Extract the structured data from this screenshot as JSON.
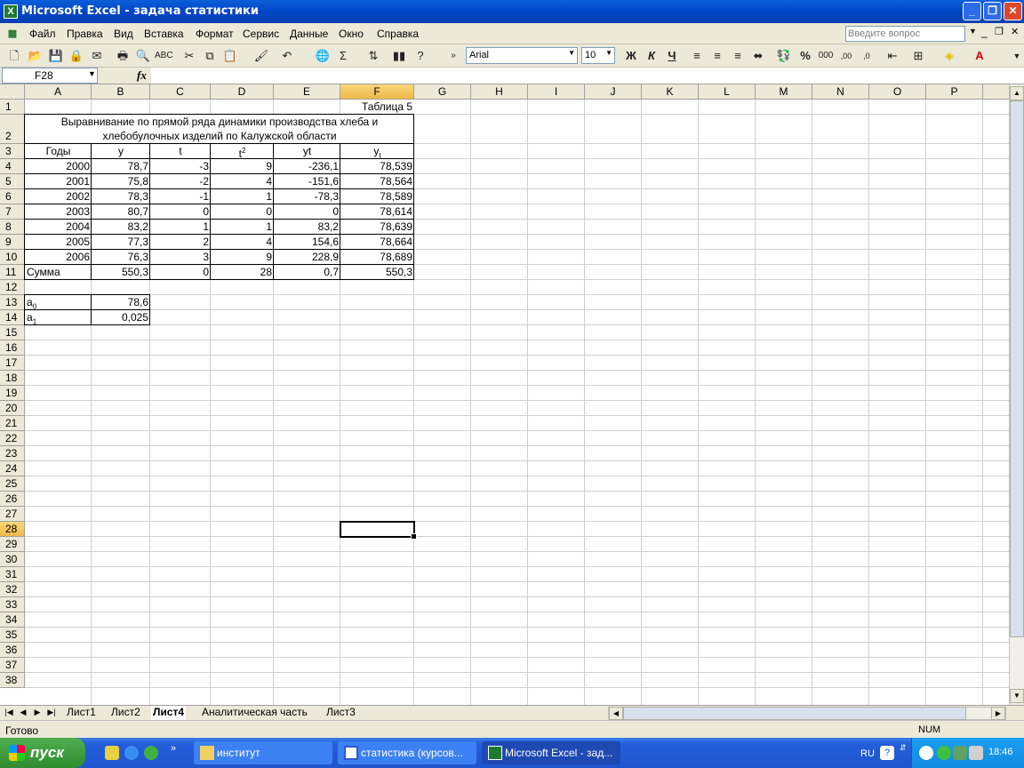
{
  "window": {
    "title": "Microsoft Excel - задача статистики",
    "app_icon": "excel-icon"
  },
  "menu": {
    "items": [
      "Файл",
      "Правка",
      "Вид",
      "Вставка",
      "Формат",
      "Сервис",
      "Данные",
      "Окно",
      "Справка"
    ],
    "help_placeholder": "Введите вопрос"
  },
  "toolbar": {
    "font": "Arial",
    "size": "10"
  },
  "formula_bar": {
    "name_box": "F28",
    "fx": "fx",
    "formula": ""
  },
  "grid": {
    "columns": [
      "A",
      "B",
      "C",
      "D",
      "E",
      "F",
      "G",
      "H",
      "I",
      "J",
      "K",
      "L",
      "M",
      "N",
      "O",
      "P"
    ],
    "selected_column": "F",
    "selected_row": "28",
    "table_label": "Таблица 5",
    "heading_line1": "Выравнивание по прямой ряда динамики производства хлеба и",
    "heading_line2": "хлебобулочных изделий по Калужской области",
    "headers": {
      "years": "Годы",
      "y": "y",
      "t": "t",
      "t2": "t",
      "t2_sup": "2",
      "yt": "yt",
      "yt_hat": "y",
      "yt_hat_sub": "t"
    },
    "rows": [
      [
        "2000",
        "78,7",
        "-3",
        "9",
        "-236,1",
        "78,539"
      ],
      [
        "2001",
        "75,8",
        "-2",
        "4",
        "-151,6",
        "78,564"
      ],
      [
        "2002",
        "78,3",
        "-1",
        "1",
        "-78,3",
        "78,589"
      ],
      [
        "2003",
        "80,7",
        "0",
        "0",
        "0",
        "78,614"
      ],
      [
        "2004",
        "83,2",
        "1",
        "1",
        "83,2",
        "78,639"
      ],
      [
        "2005",
        "77,3",
        "2",
        "4",
        "154,6",
        "78,664"
      ],
      [
        "2006",
        "76,3",
        "3",
        "9",
        "228,9",
        "78,689"
      ]
    ],
    "sum_row": [
      "Сумма",
      "550,3",
      "0",
      "28",
      "0,7",
      "550,3"
    ],
    "a0_label": "a",
    "a0_sub": "0",
    "a0_value": "78,6",
    "a1_label": "a",
    "a1_sub": "1",
    "a1_value": "0,025"
  },
  "sheets": {
    "tabs": [
      "Лист1",
      "Лист2",
      "Лист4",
      "Аналитическая часть",
      "Лист3"
    ],
    "active": "Лист4"
  },
  "status": {
    "left": "Готово",
    "num": "NUM"
  },
  "taskbar": {
    "start": "пуск",
    "buttons": [
      "институт",
      "статистика (курсов...",
      "Microsoft Excel - зад..."
    ],
    "lang": "RU",
    "clock": "18:46"
  }
}
